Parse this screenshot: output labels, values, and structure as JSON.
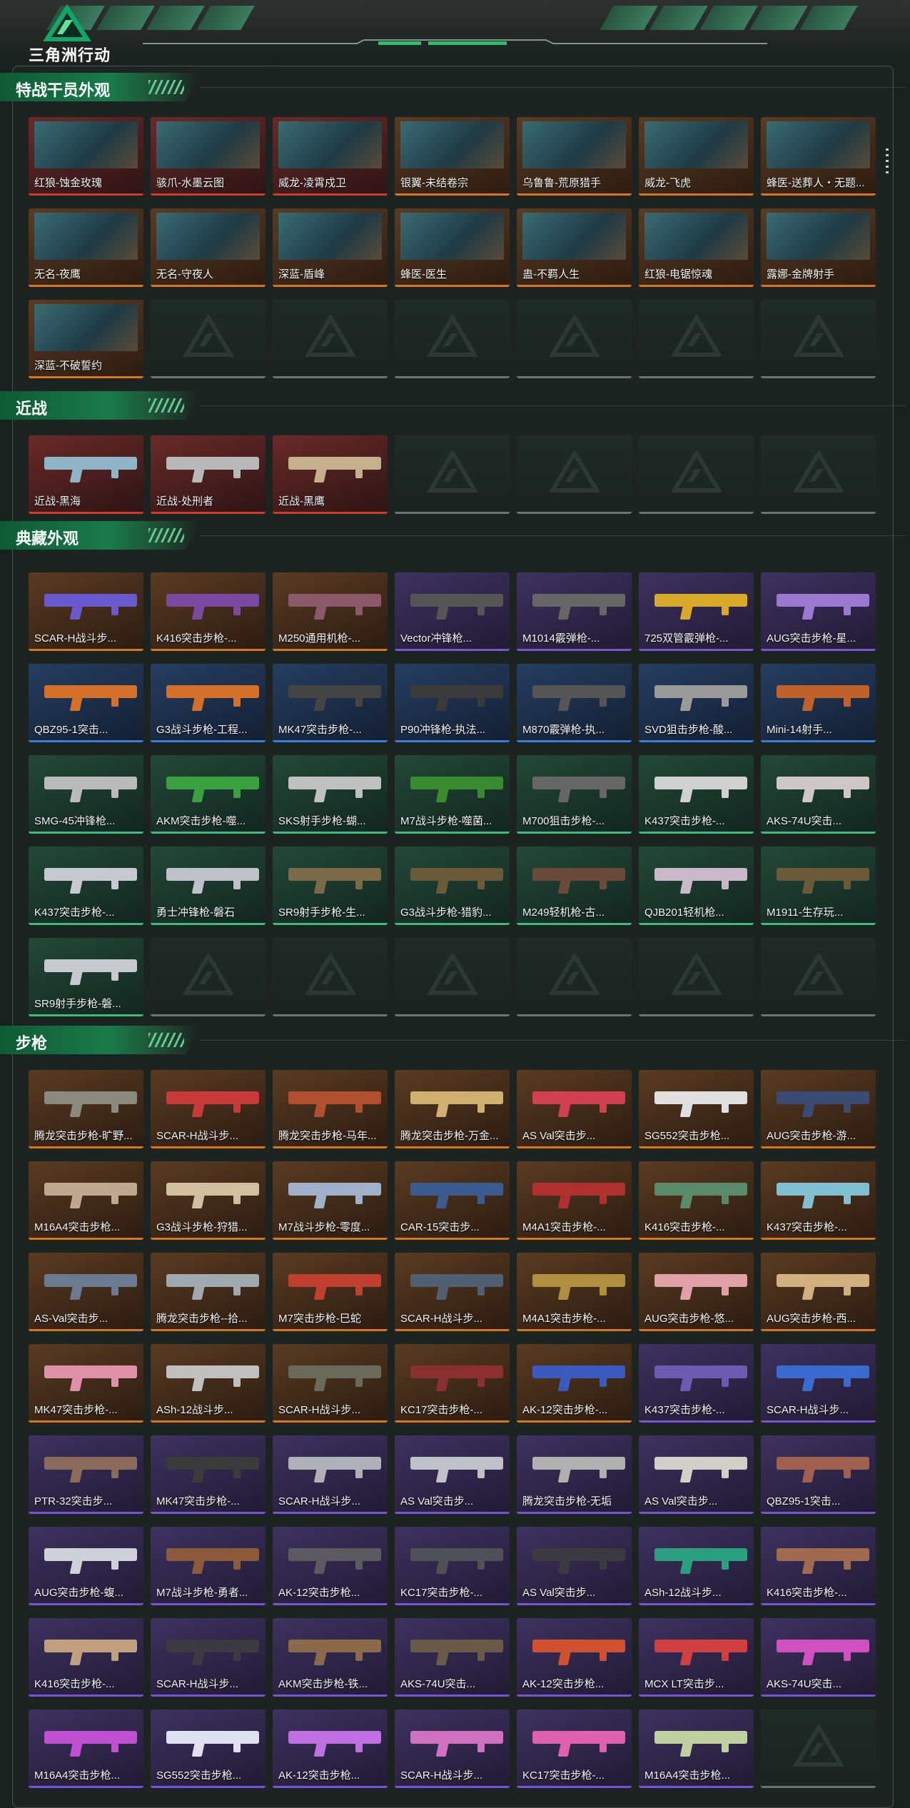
{
  "app": {
    "logo_text": "三角洲行动",
    "logo_icon": "delta-logo-icon",
    "accent": "#2fbf71"
  },
  "sections": [
    {
      "id": "operators",
      "title": "特战干员外观",
      "items": [
        {
          "label": "红狼-蚀金玫瑰",
          "rarity": "red",
          "kind": "photo"
        },
        {
          "label": "骇爪-水墨云图",
          "rarity": "red",
          "kind": "photo"
        },
        {
          "label": "威龙-凌霄戍卫",
          "rarity": "red",
          "kind": "photo"
        },
        {
          "label": "银翼-未结卷宗",
          "rarity": "gold",
          "kind": "photo"
        },
        {
          "label": "乌鲁鲁-荒原猎手",
          "rarity": "gold",
          "kind": "photo"
        },
        {
          "label": "威龙-飞虎",
          "rarity": "gold",
          "kind": "photo"
        },
        {
          "label": "蜂医-送葬人・无题...",
          "rarity": "gold",
          "kind": "photo"
        },
        {
          "label": "无名-夜鹰",
          "rarity": "gold",
          "kind": "photo"
        },
        {
          "label": "无名-守夜人",
          "rarity": "gold",
          "kind": "photo"
        },
        {
          "label": "深蓝-盾峰",
          "rarity": "gold",
          "kind": "photo"
        },
        {
          "label": "蜂医-医生",
          "rarity": "gold",
          "kind": "photo"
        },
        {
          "label": "蛊-不羁人生",
          "rarity": "gold",
          "kind": "photo"
        },
        {
          "label": "红狼-电锯惊魂",
          "rarity": "gold",
          "kind": "photo"
        },
        {
          "label": "露娜-金牌射手",
          "rarity": "gold",
          "kind": "photo"
        },
        {
          "label": "深蓝-不破誓约",
          "rarity": "gold",
          "kind": "photo"
        }
      ],
      "empty_slots": 6
    },
    {
      "id": "melee",
      "title": "近战",
      "items": [
        {
          "label": "近战-黑海",
          "rarity": "red",
          "kind": "weapon",
          "color": "#8fb4c8"
        },
        {
          "label": "近战-处刑者",
          "rarity": "red",
          "kind": "weapon",
          "color": "#b9b9b9"
        },
        {
          "label": "近战-黑鹰",
          "rarity": "red",
          "kind": "weapon",
          "color": "#c4b08c"
        }
      ],
      "empty_slots": 4
    },
    {
      "id": "collection",
      "title": "典藏外观",
      "items": [
        {
          "label": "SCAR-H战斗步...",
          "rarity": "gold",
          "kind": "weapon",
          "color": "#6a5acd"
        },
        {
          "label": "K416突击步枪-...",
          "rarity": "gold",
          "kind": "weapon",
          "color": "#7a4aa0"
        },
        {
          "label": "M250通用机枪-...",
          "rarity": "gold",
          "kind": "weapon",
          "color": "#8a5a6a"
        },
        {
          "label": "Vector冲锋枪...",
          "rarity": "purple",
          "kind": "weapon",
          "color": "#555"
        },
        {
          "label": "M1014霰弹枪-...",
          "rarity": "purple",
          "kind": "weapon",
          "color": "#666"
        },
        {
          "label": "725双管霰弹枪-...",
          "rarity": "purple",
          "kind": "weapon",
          "color": "#d9a92a"
        },
        {
          "label": "AUG突击步枪-星...",
          "rarity": "purple",
          "kind": "weapon",
          "color": "#9a7ad0"
        },
        {
          "label": "QBZ95-1突击...",
          "rarity": "blue",
          "kind": "weapon",
          "color": "#d4702a"
        },
        {
          "label": "G3战斗步枪-工程...",
          "rarity": "blue",
          "kind": "weapon",
          "color": "#d4702a"
        },
        {
          "label": "MK47突击步枪-...",
          "rarity": "blue",
          "kind": "weapon",
          "color": "#444"
        },
        {
          "label": "P90冲锋枪-执法...",
          "rarity": "blue",
          "kind": "weapon",
          "color": "#3a3a3a"
        },
        {
          "label": "M870霰弹枪-执...",
          "rarity": "blue",
          "kind": "weapon",
          "color": "#555"
        },
        {
          "label": "SVD狙击步枪-酸...",
          "rarity": "blue",
          "kind": "weapon",
          "color": "#9a9a9a"
        },
        {
          "label": "Mini-14射手...",
          "rarity": "blue",
          "kind": "weapon",
          "color": "#c0602a"
        },
        {
          "label": "SMG-45冲锋枪...",
          "rarity": "green",
          "kind": "weapon",
          "color": "#bbb"
        },
        {
          "label": "AKM突击步枪-噬...",
          "rarity": "green",
          "kind": "weapon",
          "color": "#3aa040"
        },
        {
          "label": "SKS射手步枪-蝴...",
          "rarity": "green",
          "kind": "weapon",
          "color": "#c0c0c0"
        },
        {
          "label": "M7战斗步枪-噬菌...",
          "rarity": "green",
          "kind": "weapon",
          "color": "#3a8a30"
        },
        {
          "label": "M700狙击步枪-...",
          "rarity": "green",
          "kind": "weapon",
          "color": "#666"
        },
        {
          "label": "K437突击步枪-...",
          "rarity": "green",
          "kind": "weapon",
          "color": "#d0d0d0"
        },
        {
          "label": "AKS-74U突击...",
          "rarity": "green",
          "kind": "weapon",
          "color": "#d0c8c8"
        },
        {
          "label": "K437突击步枪-...",
          "rarity": "green",
          "kind": "weapon",
          "color": "#c8c8d0"
        },
        {
          "label": "勇士冲锋枪-磐石",
          "rarity": "green",
          "kind": "weapon",
          "color": "#c0c0c8"
        },
        {
          "label": "SR9射手步枪-生...",
          "rarity": "green",
          "kind": "weapon",
          "color": "#7a6a4a"
        },
        {
          "label": "G3战斗步枪-猎豹...",
          "rarity": "green",
          "kind": "weapon",
          "color": "#6a5a3a"
        },
        {
          "label": "M249轻机枪-古...",
          "rarity": "green",
          "kind": "weapon",
          "color": "#6a4a3a"
        },
        {
          "label": "QJB201轻机枪...",
          "rarity": "green",
          "kind": "weapon",
          "color": "#c8b8c8"
        },
        {
          "label": "M1911-生存玩...",
          "rarity": "green",
          "kind": "weapon",
          "color": "#6a5a3a"
        },
        {
          "label": "SR9射手步枪-磐...",
          "rarity": "green",
          "kind": "weapon",
          "color": "#c8c8d0"
        }
      ],
      "empty_slots": 6
    },
    {
      "id": "rifles",
      "title": "步枪",
      "items": [
        {
          "label": "腾龙突击步枪-旷野...",
          "rarity": "gold",
          "kind": "weapon",
          "color": "#8a8a80"
        },
        {
          "label": "SCAR-H战斗步...",
          "rarity": "gold",
          "kind": "weapon",
          "color": "#c83a3a"
        },
        {
          "label": "腾龙突击步枪-马年...",
          "rarity": "gold",
          "kind": "weapon",
          "color": "#b05030"
        },
        {
          "label": "腾龙突击步枪-万金...",
          "rarity": "gold",
          "kind": "weapon",
          "color": "#d0b070"
        },
        {
          "label": "AS Val突击步...",
          "rarity": "gold",
          "kind": "weapon",
          "color": "#d04050"
        },
        {
          "label": "SG552突击步枪...",
          "rarity": "gold",
          "kind": "weapon",
          "color": "#e0e0e0"
        },
        {
          "label": "AUG突击步枪-游...",
          "rarity": "gold",
          "kind": "weapon",
          "color": "#3a4a70"
        },
        {
          "label": "M16A4突击步枪...",
          "rarity": "gold",
          "kind": "weapon",
          "color": "#c0a890"
        },
        {
          "label": "G3战斗步枪-狩猎...",
          "rarity": "gold",
          "kind": "weapon",
          "color": "#d0c0a0"
        },
        {
          "label": "M7战斗步枪-零度...",
          "rarity": "gold",
          "kind": "weapon",
          "color": "#a0b0c8"
        },
        {
          "label": "CAR-15突击步...",
          "rarity": "gold",
          "kind": "weapon",
          "color": "#3a5a90"
        },
        {
          "label": "M4A1突击步枪-...",
          "rarity": "gold",
          "kind": "weapon",
          "color": "#b03030"
        },
        {
          "label": "K416突击步枪-...",
          "rarity": "gold",
          "kind": "weapon",
          "color": "#5a8a6a"
        },
        {
          "label": "K437突击步枪-...",
          "rarity": "gold",
          "kind": "weapon",
          "color": "#80c0d0"
        },
        {
          "label": "AS-Val突击步...",
          "rarity": "gold",
          "kind": "weapon",
          "color": "#6a7a90"
        },
        {
          "label": "腾龙突击步枪--拾...",
          "rarity": "gold",
          "kind": "weapon",
          "color": "#a0a8b0"
        },
        {
          "label": "M7突击步枪-巳蛇",
          "rarity": "gold",
          "kind": "weapon",
          "color": "#c04030"
        },
        {
          "label": "SCAR-H战斗步...",
          "rarity": "gold",
          "kind": "weapon",
          "color": "#506070"
        },
        {
          "label": "M4A1突击步枪-...",
          "rarity": "gold",
          "kind": "weapon",
          "color": "#b09040"
        },
        {
          "label": "AUG突击步枪-悠...",
          "rarity": "gold",
          "kind": "weapon",
          "color": "#e0a0a8"
        },
        {
          "label": "AUG突击步枪-西...",
          "rarity": "gold",
          "kind": "weapon",
          "color": "#d0b080"
        },
        {
          "label": "MK47突击步枪-...",
          "rarity": "gold",
          "kind": "weapon",
          "color": "#e090a8"
        },
        {
          "label": "ASh-12战斗步...",
          "rarity": "gold",
          "kind": "weapon",
          "color": "#c0c0c0"
        },
        {
          "label": "SCAR-H战斗步...",
          "rarity": "gold",
          "kind": "weapon",
          "color": "#6a6a5a"
        },
        {
          "label": "KC17突击步枪-...",
          "rarity": "gold",
          "kind": "weapon",
          "color": "#8a3030"
        },
        {
          "label": "AK-12突击步枪-...",
          "rarity": "gold",
          "kind": "weapon",
          "color": "#3a5ac0"
        },
        {
          "label": "K437突击步枪-...",
          "rarity": "purple",
          "kind": "weapon",
          "color": "#6a5ab0"
        },
        {
          "label": "SCAR-H战斗步...",
          "rarity": "purple",
          "kind": "weapon",
          "color": "#3a6ad0"
        },
        {
          "label": "PTR-32突击步...",
          "rarity": "purple",
          "kind": "weapon",
          "color": "#8a6a5a"
        },
        {
          "label": "MK47突击步枪-...",
          "rarity": "purple",
          "kind": "weapon",
          "color": "#3a3a3a"
        },
        {
          "label": "SCAR-H战斗步...",
          "rarity": "purple",
          "kind": "weapon",
          "color": "#b0b0b8"
        },
        {
          "label": "AS Val突击步...",
          "rarity": "purple",
          "kind": "weapon",
          "color": "#c0c0c8"
        },
        {
          "label": "腾龙突击步枪-无垢",
          "rarity": "purple",
          "kind": "weapon",
          "color": "#b0b0b0"
        },
        {
          "label": "AS Val突击步...",
          "rarity": "purple",
          "kind": "weapon",
          "color": "#d0d0c8"
        },
        {
          "label": "QBZ95-1突击...",
          "rarity": "purple",
          "kind": "weapon",
          "color": "#a06050"
        },
        {
          "label": "AUG突击步枪-蝮...",
          "rarity": "purple",
          "kind": "weapon",
          "color": "#d0d0d8"
        },
        {
          "label": "M7战斗步枪-勇者...",
          "rarity": "purple",
          "kind": "weapon",
          "color": "#8a5a3a"
        },
        {
          "label": "AK-12突击步枪...",
          "rarity": "purple",
          "kind": "weapon",
          "color": "#5a5a60"
        },
        {
          "label": "KC17突击步枪-...",
          "rarity": "purple",
          "kind": "weapon",
          "color": "#505058"
        },
        {
          "label": "AS Val突击步...",
          "rarity": "purple",
          "kind": "weapon",
          "color": "#3a3a40"
        },
        {
          "label": "ASh-12战斗步...",
          "rarity": "purple",
          "kind": "weapon",
          "color": "#2aa080"
        },
        {
          "label": "K416突击步枪-...",
          "rarity": "purple",
          "kind": "weapon",
          "color": "#a06a50"
        },
        {
          "label": "K416突击步枪-...",
          "rarity": "purple",
          "kind": "weapon",
          "color": "#c0a080"
        },
        {
          "label": "SCAR-H战斗步...",
          "rarity": "purple",
          "kind": "weapon",
          "color": "#3a3a40"
        },
        {
          "label": "AKM突击步枪-铁...",
          "rarity": "purple",
          "kind": "weapon",
          "color": "#8a6a4a"
        },
        {
          "label": "AKS-74U突击...",
          "rarity": "purple",
          "kind": "weapon",
          "color": "#6a5a4a"
        },
        {
          "label": "AK-12突击步枪...",
          "rarity": "purple",
          "kind": "weapon",
          "color": "#d05030"
        },
        {
          "label": "MCX LT突击步...",
          "rarity": "purple",
          "kind": "weapon",
          "color": "#d04040"
        },
        {
          "label": "AKS-74U突击...",
          "rarity": "purple",
          "kind": "weapon",
          "color": "#d050c0"
        },
        {
          "label": "M16A4突击步枪...",
          "rarity": "purple",
          "kind": "weapon",
          "color": "#c050d0"
        },
        {
          "label": "SG552突击步枪...",
          "rarity": "purple",
          "kind": "weapon",
          "color": "#e0e0f0"
        },
        {
          "label": "AK-12突击步枪...",
          "rarity": "purple",
          "kind": "weapon",
          "color": "#c070e0"
        },
        {
          "label": "SCAR-H战斗步...",
          "rarity": "purple",
          "kind": "weapon",
          "color": "#d070c0"
        },
        {
          "label": "KC17突击步枪-...",
          "rarity": "purple",
          "kind": "weapon",
          "color": "#e060b0"
        },
        {
          "label": "M16A4突击步枪...",
          "rarity": "purple",
          "kind": "weapon",
          "color": "#c0d0a0"
        }
      ],
      "empty_slots": 1
    }
  ]
}
